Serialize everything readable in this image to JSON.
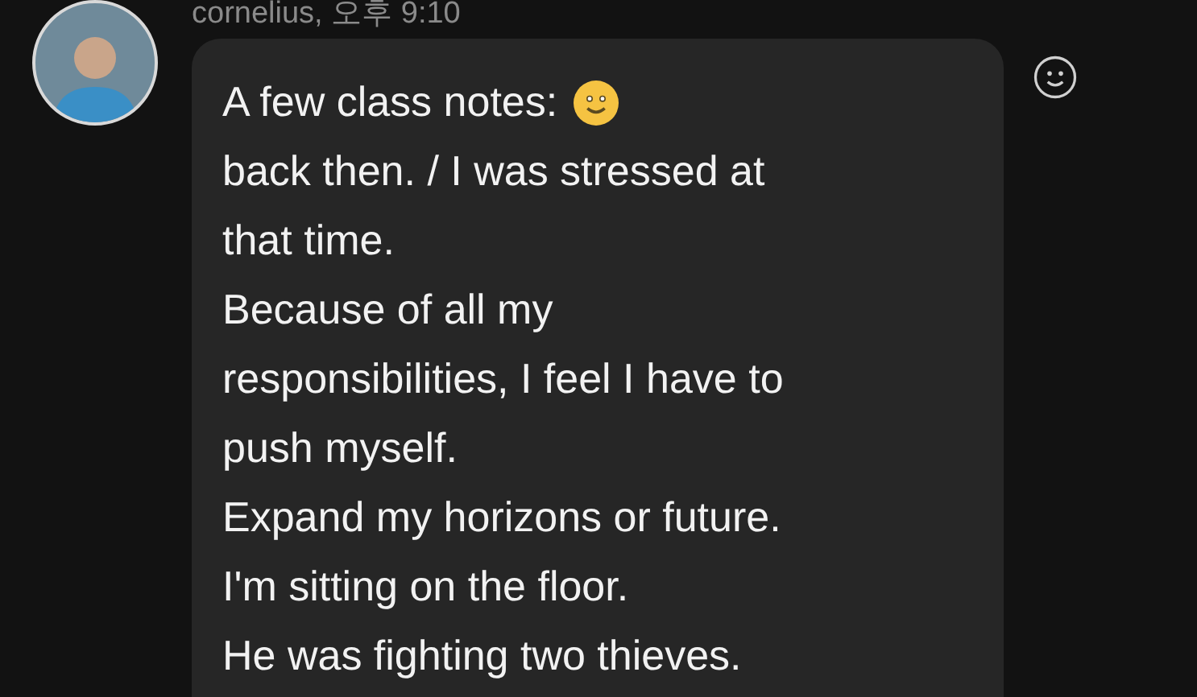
{
  "message": {
    "sender": "cornelius, 오후 9:10",
    "lines": [
      "A few class notes:",
      "back then. / I was stressed at",
      "that time.",
      "Because of all my",
      "responsibilities, I feel I have to",
      "push myself.",
      "Expand my horizons or future.",
      "I'm sitting on the floor.",
      "He was fighting two thieves."
    ]
  }
}
